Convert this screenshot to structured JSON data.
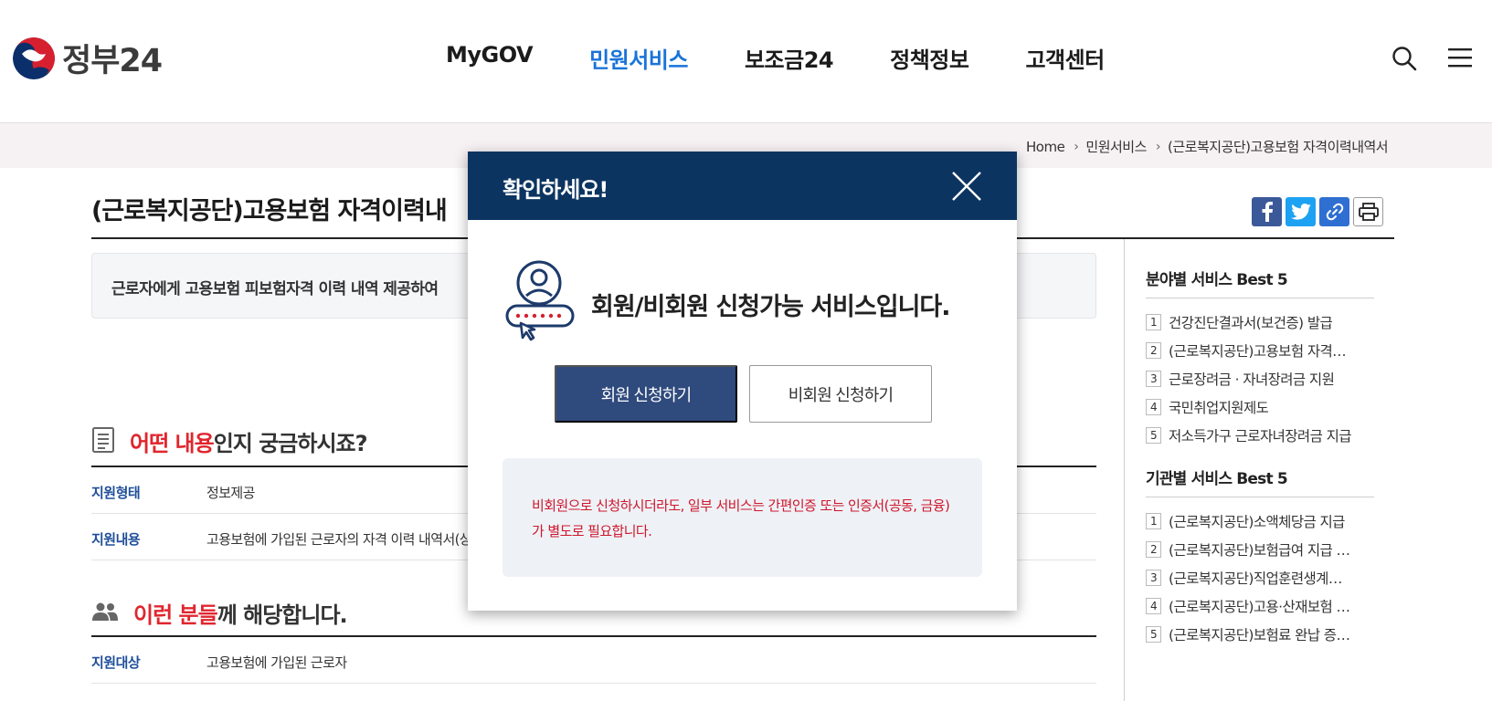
{
  "header": {
    "logo_text": "정부24",
    "nav": [
      "MyGOV",
      "민원서비스",
      "보조금24",
      "정책정보",
      "고객센터"
    ],
    "active_nav": "민원서비스",
    "icons": [
      "search-icon",
      "menu-icon"
    ]
  },
  "breadcrumb": {
    "home": "Home",
    "level1": "민원서비스",
    "current": "(근로복지공단)고용보험 자격이력내역서"
  },
  "page": {
    "title": "(근로복지공단)고용보험 자격이력내",
    "summary": "근로자에게 고용보험 피보험자격 이력 내역 제공하여"
  },
  "section1": {
    "title_highlight": "어떤 내용",
    "title_rest": "인지 궁금하시죠?",
    "rows": [
      {
        "label": "지원형태",
        "value": "정보제공"
      },
      {
        "label": "지원내용",
        "value": "고용보험에 가입된 근로자의 자격 이력 내역서(상"
      }
    ]
  },
  "section2": {
    "title_highlight": "이런 분들",
    "title_rest": "께 해당합니다.",
    "rows": [
      {
        "label": "지원대상",
        "value": "고용보험에 가입된 근로자"
      }
    ]
  },
  "sidebar": {
    "field_best": {
      "title": "분야별 서비스 Best 5",
      "items": [
        {
          "num": "1",
          "text": "건강진단결과서(보건증) 발급"
        },
        {
          "num": "2",
          "text": "(근로복지공단)고용보험 자격…"
        },
        {
          "num": "3",
          "text": "근로장려금 · 자녀장려금 지원"
        },
        {
          "num": "4",
          "text": "국민취업지원제도"
        },
        {
          "num": "5",
          "text": "저소득가구 근로자녀장려금 지급"
        }
      ]
    },
    "org_best": {
      "title": "기관별 서비스 Best 5",
      "items": [
        {
          "num": "1",
          "text": "(근로복지공단)소액체당금 지급"
        },
        {
          "num": "2",
          "text": "(근로복지공단)보험급여 지급 …"
        },
        {
          "num": "3",
          "text": "(근로복지공단)직업훈련생계…"
        },
        {
          "num": "4",
          "text": "(근로복지공단)고용·산재보험 …"
        },
        {
          "num": "5",
          "text": "(근로복지공단)보험료 완납 증…"
        }
      ]
    }
  },
  "modal": {
    "title": "확인하세요!",
    "message": "회원/비회원 신청가능 서비스입니다.",
    "member_button": "회원 신청하기",
    "guest_button": "비회원 신청하기",
    "notice": "비회원으로 신청하시더라도, 일부 서비스는 간편인증 또는 인증서(공동, 금융) 가 별도로 필요합니다."
  },
  "colors": {
    "brand_blue": "#1a73d9",
    "modal_header": "#0c3461",
    "member_button": "#2f4a7c",
    "highlight_red": "#e0262e",
    "label_blue": "#1f4f9a"
  }
}
